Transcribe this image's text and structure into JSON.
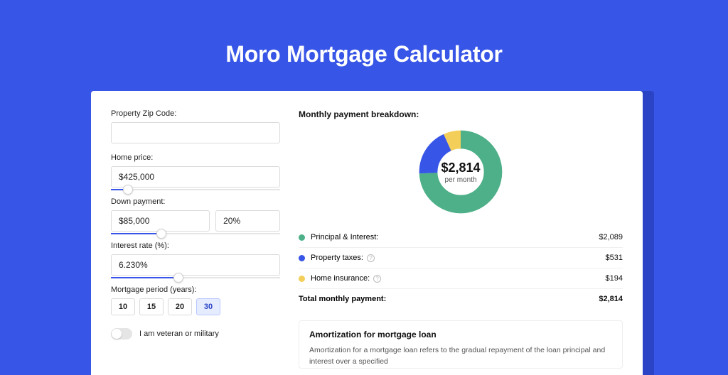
{
  "hero": {
    "title": "Moro Mortgage Calculator"
  },
  "form": {
    "zip": {
      "label": "Property Zip Code:",
      "value": ""
    },
    "home_price": {
      "label": "Home price:",
      "value": "$425,000",
      "slider_pct": 10
    },
    "down_payment": {
      "label": "Down payment:",
      "amount": "$85,000",
      "percent": "20%",
      "slider_pct": 30
    },
    "interest_rate": {
      "label": "Interest rate (%):",
      "value": "6.230%",
      "slider_pct": 40
    },
    "mortgage_period": {
      "label": "Mortgage period (years):",
      "options": [
        "10",
        "15",
        "20",
        "30"
      ],
      "selected_index": 3
    },
    "veteran": {
      "label": "I am veteran or military",
      "checked": false
    }
  },
  "breakdown": {
    "title": "Monthly payment breakdown:",
    "center_amount": "$2,814",
    "center_sub": "per month",
    "items": [
      {
        "label": "Principal & Interest:",
        "value": "$2,089",
        "color": "#4eb088",
        "info": false
      },
      {
        "label": "Property taxes:",
        "value": "$531",
        "color": "#3755e6",
        "info": true
      },
      {
        "label": "Home insurance:",
        "value": "$194",
        "color": "#f3cf5a",
        "info": true
      }
    ],
    "total": {
      "label": "Total monthly payment:",
      "value": "$2,814"
    }
  },
  "chart_data": {
    "type": "pie",
    "title": "Monthly payment breakdown",
    "series": [
      {
        "name": "Principal & Interest",
        "value": 2089,
        "color": "#4eb088"
      },
      {
        "name": "Property taxes",
        "value": 531,
        "color": "#3755e6"
      },
      {
        "name": "Home insurance",
        "value": 194,
        "color": "#f3cf5a"
      }
    ],
    "total": 2814,
    "unit": "USD per month"
  },
  "amortization": {
    "title": "Amortization for mortgage loan",
    "body": "Amortization for a mortgage loan refers to the gradual repayment of the loan principal and interest over a specified"
  }
}
